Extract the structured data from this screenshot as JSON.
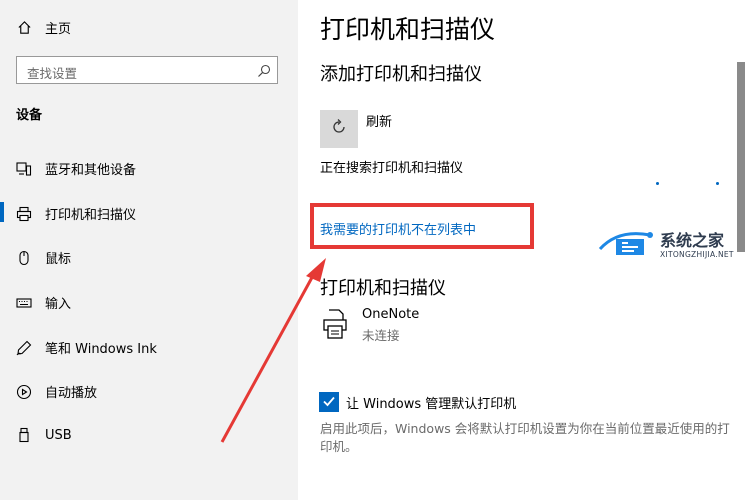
{
  "sidebar": {
    "home_label": "主页",
    "search_placeholder": "查找设置",
    "category": "设备",
    "items": [
      {
        "label": "蓝牙和其他设备",
        "icon": "bluetooth-devices-icon"
      },
      {
        "label": "打印机和扫描仪",
        "icon": "printer-icon"
      },
      {
        "label": "鼠标",
        "icon": "mouse-icon"
      },
      {
        "label": "输入",
        "icon": "keyboard-icon"
      },
      {
        "label": "笔和 Windows Ink",
        "icon": "pen-icon"
      },
      {
        "label": "自动播放",
        "icon": "autoplay-icon"
      },
      {
        "label": "USB",
        "icon": "usb-icon"
      }
    ],
    "active_index": 1
  },
  "main": {
    "title": "打印机和扫描仪",
    "add_section_title": "添加打印机和扫描仪",
    "refresh_label": "刷新",
    "searching_text": "正在搜索打印机和扫描仪",
    "missing_printer_link": "我需要的打印机不在列表中",
    "printers_section_title": "打印机和扫描仪",
    "printers": [
      {
        "name": "OneNote",
        "status": "未连接"
      }
    ],
    "default_printer_checkbox": {
      "label": "让 Windows 管理默认打印机",
      "checked": true
    },
    "default_printer_description": "启用此项后，Windows 会将默认打印机设置为你在当前位置最近使用的打印机。"
  },
  "watermark": {
    "name": "系统之家",
    "url": "XITONGZHIJIA.NET"
  },
  "colors": {
    "accent": "#0067c0",
    "highlight_frame": "#e53935",
    "sidebar_bg": "#f2f2f2"
  }
}
